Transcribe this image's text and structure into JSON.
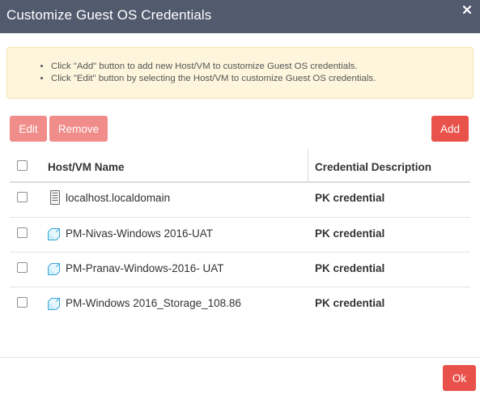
{
  "dialog": {
    "title": "Customize Guest OS Credentials"
  },
  "info": {
    "items": [
      "Click \"Add\" button to add new Host/VM to customize Guest OS credentials.",
      "Click \"Edit\" button by selecting the Host/VM to customize Guest OS credentials."
    ]
  },
  "toolbar": {
    "edit_label": "Edit",
    "remove_label": "Remove",
    "add_label": "Add"
  },
  "table": {
    "columns": [
      "Host/VM Name",
      "Credential Description"
    ],
    "rows": [
      {
        "name": "localhost.localdomain",
        "credential": "PK credential",
        "icon": "server-icon",
        "checked": false
      },
      {
        "name": "PM-Nivas-Windows 2016-UAT",
        "credential": "PK credential",
        "icon": "vm-icon",
        "checked": false
      },
      {
        "name": "PM-Pranav-Windows-2016- UAT",
        "credential": "PK credential",
        "icon": "vm-icon",
        "checked": false
      },
      {
        "name": "PM-Windows 2016_Storage_108.86",
        "credential": "PK credential",
        "icon": "vm-icon",
        "checked": false
      }
    ]
  },
  "footer": {
    "ok_label": "Ok"
  },
  "colors": {
    "titlebar": "#525a6e",
    "accent": "#e9524a",
    "accent_disabled": "#f08c89",
    "info_bg": "#fdf6dd",
    "vm_icon": "#3aa6d8"
  }
}
